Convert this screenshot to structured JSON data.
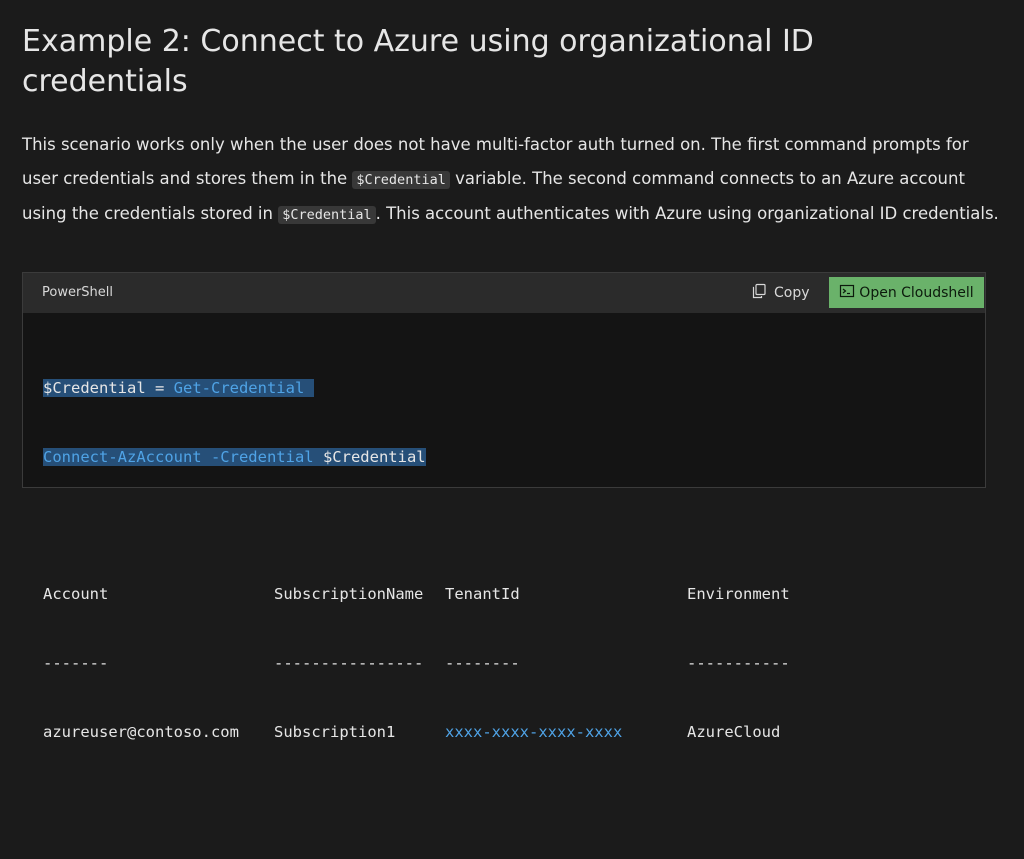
{
  "heading": "Example 2: Connect to Azure using organizational ID credentials",
  "paragraph": {
    "part1": "This scenario works only when the user does not have multi-factor auth turned on. The first command prompts for user credentials and stores them in the ",
    "code1": "$Credential",
    "part2": " variable. The second command connects to an Azure account using the credentials stored in ",
    "code2": "$Credential",
    "part3": ". This account authenticates with Azure using organizational ID credentials."
  },
  "code_block": {
    "language": "PowerShell",
    "copy_label": "Copy",
    "cloudshell_label": "Open Cloudshell",
    "accent_color": "#6ab26a",
    "line1": {
      "var": "$Credential",
      "op": " = ",
      "cmd": "Get-Credential"
    },
    "line2": {
      "cmd": "Connect-AzAccount",
      "param": " -Credential",
      "var": " $Credential"
    },
    "output": {
      "headers": [
        "Account",
        "SubscriptionName",
        "TenantId",
        "Environment"
      ],
      "dashes": [
        "-------",
        "----------------",
        "--------",
        "-----------"
      ],
      "values": [
        "azureuser@contoso.com",
        "Subscription1",
        "xxxx-xxxx-xxxx-xxxx",
        "AzureCloud"
      ]
    }
  }
}
